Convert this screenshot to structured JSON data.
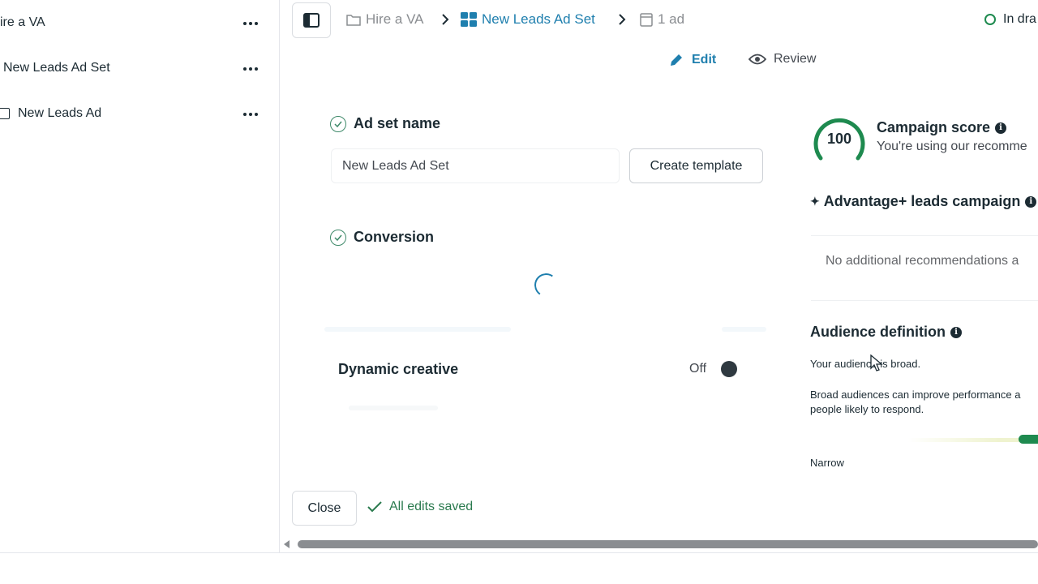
{
  "sidebar": {
    "items": [
      {
        "label": "ire a VA",
        "more": "..."
      },
      {
        "label": "New Leads Ad Set",
        "more": "..."
      },
      {
        "label": "New Leads Ad",
        "more": "..."
      }
    ]
  },
  "breadcrumb": {
    "campaign": "Hire a VA",
    "ad_set": "New Leads Ad Set",
    "ads": "1 ad"
  },
  "status": "In dra",
  "modes": {
    "edit": "Edit",
    "review": "Review"
  },
  "form": {
    "ad_set_name_title": "Ad set name",
    "ad_set_name_value": "New Leads Ad Set",
    "create_template": "Create template",
    "conversion_title": "Conversion",
    "dynamic_creative_title": "Dynamic creative",
    "dynamic_creative_state": "Off"
  },
  "right_panel": {
    "score": "100",
    "score_title": "Campaign score",
    "score_subtitle": "You're using our recomme",
    "advantage_title": "Advantage+ leads campaign",
    "no_recs": "No additional recommendations a",
    "audience_title": "Audience definition",
    "audience_line1": "Your audience is broad.",
    "audience_line2": "Broad audiences can improve performance a",
    "audience_line3": "people likely to respond.",
    "narrow_label": "Narrow"
  },
  "footer": {
    "close": "Close",
    "saved": "All edits saved"
  },
  "colors": {
    "link_blue": "#1f7fae",
    "success_green": "#1e8a4f"
  }
}
